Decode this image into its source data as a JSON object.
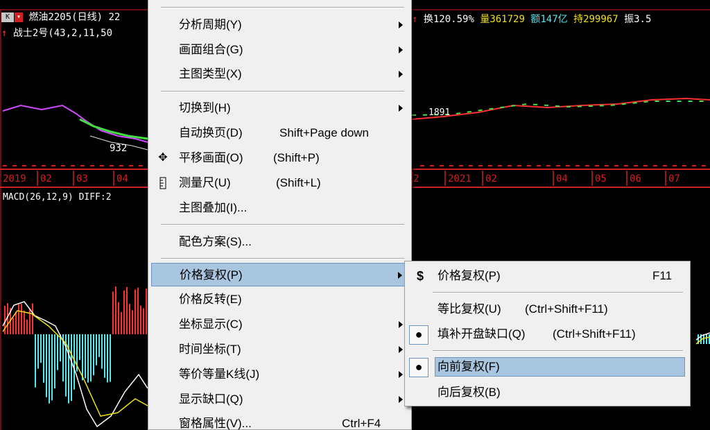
{
  "chart": {
    "k_button": "K",
    "symbol": "燃油2205(日线)",
    "price_partial": "22",
    "indicator": "战士2号(43,2,11,50",
    "stats": {
      "turnover": "换120.59%",
      "volume": "量361729",
      "amount": "额147亿",
      "hold": "持299967",
      "amplitude": "振3.5"
    },
    "low_label": "932",
    "mid_label": "1891",
    "macd_label": "MACD(26,12,9) DIFF:2",
    "axis_left": [
      "2019",
      "02",
      "03",
      "04"
    ],
    "axis_right": [
      "2",
      "2021",
      "02",
      "04",
      "05",
      "06",
      "07"
    ],
    "colors": {
      "up": "#ff3030",
      "down": "#54e8f0",
      "green_line": "#40e040",
      "yellow": "#f0e020",
      "axis": "#d02020"
    }
  },
  "main_menu": {
    "items": [
      {
        "label": "分析周期(Y)",
        "submenu": true
      },
      {
        "label": "画面组合(G)",
        "submenu": true
      },
      {
        "label": "主图类型(X)",
        "submenu": true
      },
      {
        "label": "切换到(H)",
        "submenu": true
      },
      {
        "label": "自动换页(D)",
        "shortcut": "Shift+Page down"
      },
      {
        "label": "平移画面(O)",
        "shortcut": "(Shift+P)",
        "icon": "move-icon"
      },
      {
        "label": "测量尺(U)",
        "shortcut": "(Shift+L)",
        "icon": "ruler-icon"
      },
      {
        "label": "主图叠加(I)..."
      },
      {
        "label": "配色方案(S)..."
      },
      {
        "label": "价格复权(P)",
        "submenu": true,
        "highlighted": true
      },
      {
        "label": "价格反转(E)"
      },
      {
        "label": "坐标显示(C)",
        "submenu": true
      },
      {
        "label": "时间坐标(T)",
        "submenu": true
      },
      {
        "label": "等价等量K线(J)",
        "submenu": true
      },
      {
        "label": "显示缺口(Q)",
        "submenu": true
      },
      {
        "label": "窗格属性(V)...",
        "shortcut": "Ctrl+F4"
      }
    ]
  },
  "sub_menu": {
    "items": [
      {
        "label": "价格复权(P)",
        "shortcut": "F11",
        "icon": "dollar-icon"
      },
      {
        "label": "等比复权(U)",
        "shortcut": "(Ctrl+Shift+F11)"
      },
      {
        "label": "填补开盘缺口(Q)",
        "shortcut": "(Ctrl+Shift+F11)",
        "checked": true
      },
      {
        "label": "向前复权(F)",
        "checked": true,
        "highlighted": true
      },
      {
        "label": "向后复权(B)"
      }
    ]
  }
}
